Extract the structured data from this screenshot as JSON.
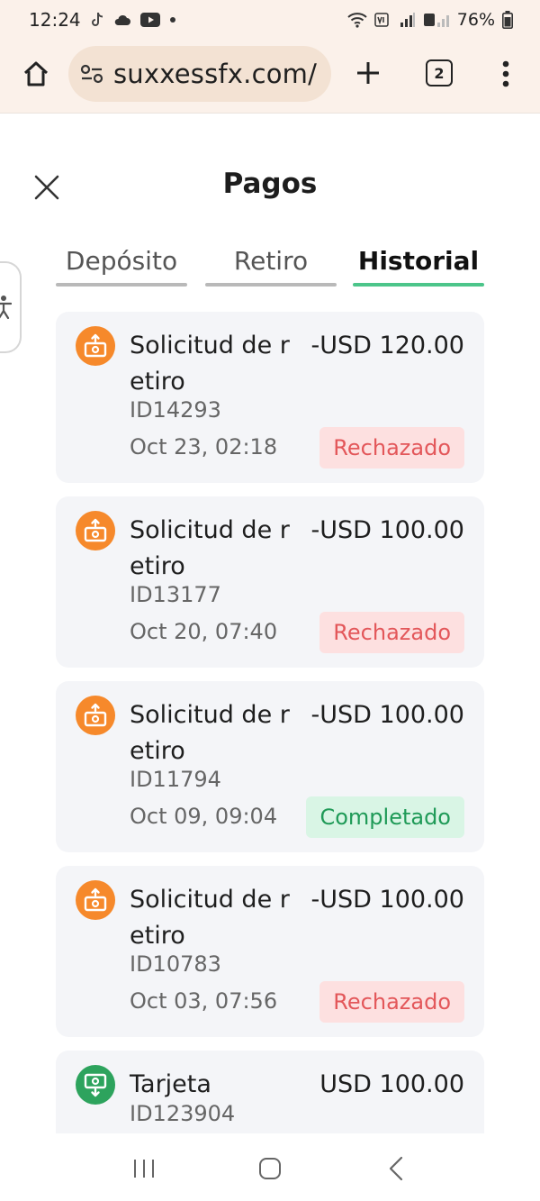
{
  "status_bar": {
    "time": "12:24",
    "battery": "76%",
    "icons": [
      "tiktok-icon",
      "cloud-icon",
      "youtube-icon",
      "dot-icon",
      "wifi-icon",
      "volte-icon",
      "signal-icon",
      "battery-icon"
    ]
  },
  "browser": {
    "url": "suxxessfx.com/",
    "tab_count": "2"
  },
  "page": {
    "title": "Pagos"
  },
  "tabs": [
    {
      "label": "Depósito",
      "active": false
    },
    {
      "label": "Retiro",
      "active": false
    },
    {
      "label": "Historial",
      "active": true
    }
  ],
  "history": [
    {
      "title": "Solicitud de retiro",
      "amount": "-USD 120.00",
      "id": "ID14293",
      "date": "Oct 23, 02:18",
      "status": "Rechazado",
      "type": "withdraw",
      "status_color": "#e3575a"
    },
    {
      "title": "Solicitud de retiro",
      "amount": "-USD 100.00",
      "id": "ID13177",
      "date": "Oct 20, 07:40",
      "status": "Rechazado",
      "type": "withdraw",
      "status_color": "#e3575a"
    },
    {
      "title": "Solicitud de retiro",
      "amount": "-USD 100.00",
      "id": "ID11794",
      "date": "Oct 09, 09:04",
      "status": "Completado",
      "type": "withdraw",
      "status_color": "#1f9a57"
    },
    {
      "title": "Solicitud de retiro",
      "amount": "-USD 100.00",
      "id": "ID10783",
      "date": "Oct 03, 07:56",
      "status": "Rechazado",
      "type": "withdraw",
      "status_color": "#e3575a"
    },
    {
      "title": "Tarjeta",
      "amount": "USD 100.00",
      "id": "ID123904",
      "type": "deposit"
    }
  ],
  "colors": {
    "accent": "#4cc58a",
    "withdraw_icon": "#f6892b",
    "deposit_icon": "#2da35d",
    "rejected": "#e3575a",
    "completed": "#1f9a57",
    "browser_chrome": "#fbf1ea"
  }
}
